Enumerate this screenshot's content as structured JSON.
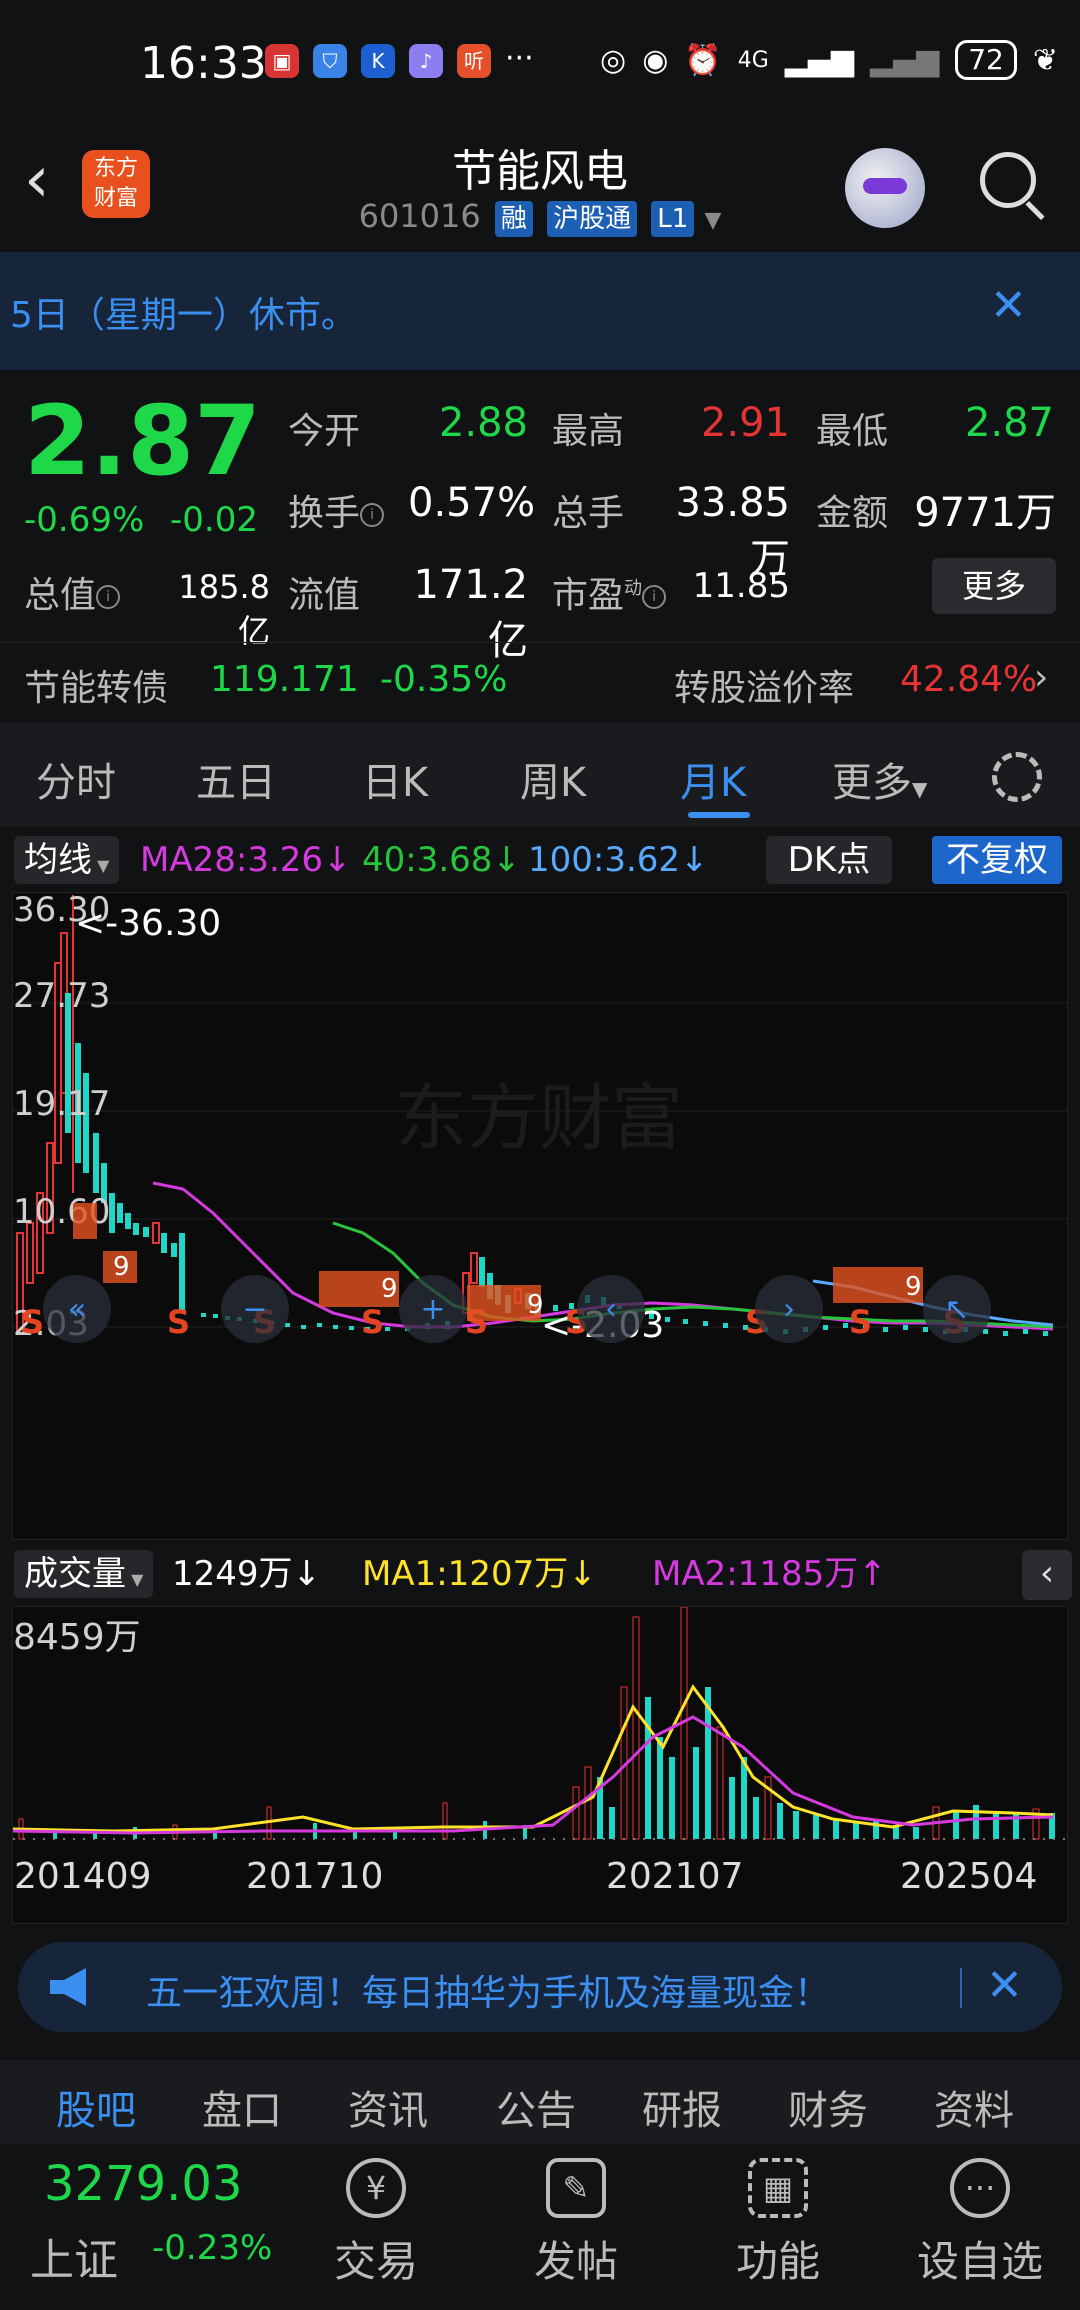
{
  "status_bar": {
    "time": "16:33",
    "network": "4G",
    "battery": "72"
  },
  "header": {
    "brand": "东方财富",
    "title": "节能风电",
    "code": "601016",
    "tags": [
      "融",
      "沪股通",
      "L1"
    ]
  },
  "notice": {
    "text": "5日（星期一）休市。"
  },
  "quote": {
    "price": "2.87",
    "change_pct": "-0.69%",
    "change": "-0.02",
    "rows": [
      [
        {
          "k": "今开",
          "v": "2.88",
          "c": "green"
        },
        {
          "k": "最高",
          "v": "2.91",
          "c": "red"
        },
        {
          "k": "最低",
          "v": "2.87",
          "c": "green"
        }
      ],
      [
        {
          "k": "换手",
          "v": "0.57%",
          "c": "white"
        },
        {
          "k": "总手",
          "v": "33.85万",
          "c": "white"
        },
        {
          "k": "金额",
          "v": "9771万",
          "c": "white"
        }
      ]
    ],
    "total_value_label": "总值",
    "total_value": "185.8亿",
    "float_value_label": "流值",
    "float_value": "171.2亿",
    "pe_label": "市盈",
    "pe_sup": "动",
    "pe": "11.85",
    "more": "更多"
  },
  "bond": {
    "name": "节能转债",
    "price": "119.171",
    "change": "-0.35%",
    "premium_label": "转股溢价率",
    "premium": "42.84%"
  },
  "tabs": [
    "分时",
    "五日",
    "日K",
    "周K",
    "月K",
    "更多"
  ],
  "active_tab": "月K",
  "ma_bar": {
    "select": "均线",
    "ma28": "MA28:3.26↓",
    "ma40": "40:3.68↓",
    "ma100": "100:3.62↓",
    "dk": "DK点",
    "adjust": "不复权"
  },
  "kline": {
    "y_labels": [
      "36.30",
      "27.73",
      "19.17",
      "10.60",
      "2.03"
    ],
    "max_note": "<-36.30",
    "min_note": "<-2.03",
    "watermark": "东方财富"
  },
  "volume_bar": {
    "select": "成交量",
    "vol": "1249万↓",
    "ma1": "MA1:1207万↓",
    "ma2": "MA2:1185万↑",
    "max_label": "8459万"
  },
  "x_labels": [
    "201409",
    "201710",
    "202107",
    "202504"
  ],
  "ad": {
    "text": "五一狂欢周！每日抽华为手机及海量现金！"
  },
  "bottom_tabs": [
    "股吧",
    "盘口",
    "资讯",
    "公告",
    "研报",
    "财务",
    "资料"
  ],
  "index": {
    "value": "3279.03",
    "name": "上证",
    "change": "-0.23%"
  },
  "nav": [
    "交易",
    "发帖",
    "功能",
    "设自选"
  ],
  "colors": {
    "up": "#e63333",
    "down": "#1ed84a",
    "accent": "#3b8ff0",
    "ma28": "#d63adf",
    "ma40": "#28c43b",
    "ma100": "#58aaff",
    "vol_ma1": "#ffe22a",
    "vol_ma2": "#d63adf"
  }
}
